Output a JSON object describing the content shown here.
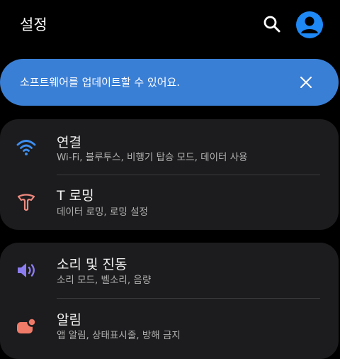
{
  "header": {
    "title": "설정",
    "icons": [
      "search-icon",
      "account-icon"
    ]
  },
  "banner": {
    "text": "소프트웨어를 업데이트할 수 있어요.",
    "close_icon": "close-icon",
    "color": "#3a7fd6"
  },
  "groups": [
    {
      "items": [
        {
          "title": "연결",
          "subtitle": "Wi-Fi, 블루투스, 비행기 탑승 모드, 데이터 사용",
          "icon": "wifi-icon",
          "icon_color": "#3d8ef0"
        },
        {
          "title": "T 로밍",
          "subtitle": "데이터 로밍, 로밍 설정",
          "icon": "roaming-icon",
          "icon_color": "#f08a80"
        }
      ]
    },
    {
      "items": [
        {
          "title": "소리 및 진동",
          "subtitle": "소리 모드, 벨소리, 음량",
          "icon": "volume-icon",
          "icon_color": "#8b7cf0"
        },
        {
          "title": "알림",
          "subtitle": "앱 알림, 상태표시줄, 방해 금지",
          "icon": "notification-icon",
          "icon_color": "#f07a68"
        }
      ]
    }
  ]
}
